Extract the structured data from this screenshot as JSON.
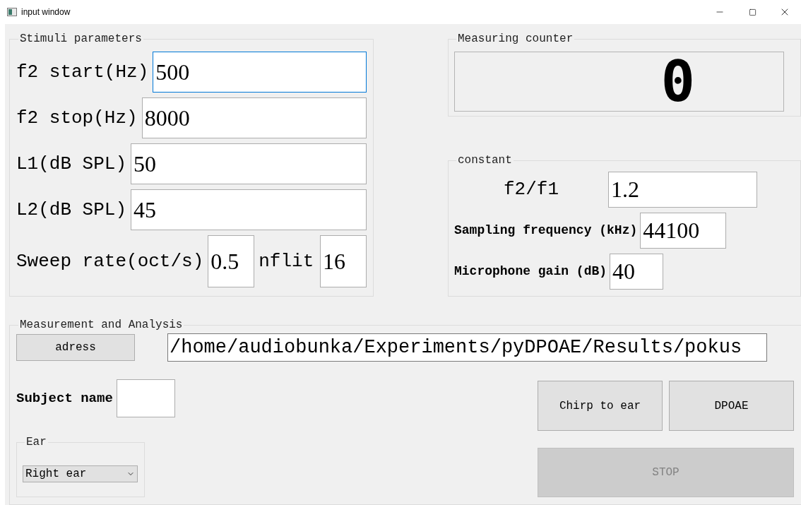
{
  "window": {
    "title": "input window"
  },
  "stimuli": {
    "title": "Stimuli parameters",
    "fields": [
      {
        "label": "f2 start(Hz)",
        "value": "500",
        "focused": true
      },
      {
        "label": "f2 stop(Hz)",
        "value": "8000",
        "focused": false
      },
      {
        "label": "L1(dB SPL)",
        "value": "50",
        "focused": false
      },
      {
        "label": "L2(dB SPL)",
        "value": "45",
        "focused": false
      }
    ],
    "sweep": {
      "label": "Sweep rate(oct/s)",
      "value": "0.5"
    },
    "nflit": {
      "label": "nflit",
      "value": "16"
    }
  },
  "counter": {
    "title": "Measuring counter",
    "value": "0"
  },
  "constant": {
    "title": "constant",
    "rows": [
      {
        "kind": "large",
        "label": "f2/f1",
        "value": "1.2"
      },
      {
        "kind": "small",
        "label": "Sampling frequency (kHz)",
        "value": "44100"
      },
      {
        "kind": "small",
        "label": "Microphone gain (dB)",
        "value": "40"
      }
    ]
  },
  "measurement": {
    "title": "Measurement and Analysis",
    "address_button": "adress",
    "path": "/home/audiobunka/Experiments/pyDPOAE/Results/pokus",
    "subject_label": "Subject name",
    "ear": {
      "title": "Ear",
      "value": "Right ear"
    },
    "buttons": [
      {
        "label": "Chirp to ear",
        "disabled": false
      },
      {
        "label": "DPOAE",
        "disabled": false
      },
      {
        "label": "STOP",
        "disabled": true
      }
    ]
  }
}
